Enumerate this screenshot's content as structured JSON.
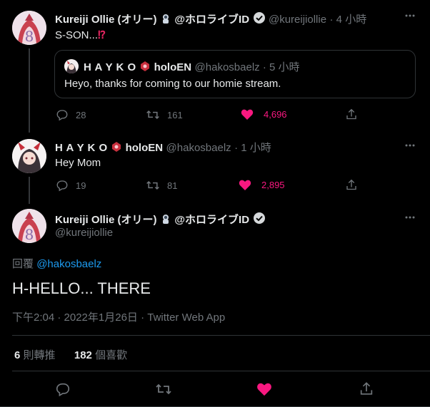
{
  "tweet1": {
    "name": "Kureiji Ollie (オリー)",
    "name_suffix": "@ホロライブID",
    "handle": "@kureijiollie",
    "time": "· 4 小時",
    "text": "S-SON...",
    "emoji": "⁉",
    "quote": {
      "name": "H A Y K O",
      "name_suffix": "holoEN",
      "handle": "@hakosbaelz · 5 小時",
      "text": "Heyo, thanks for coming to our homie stream."
    },
    "replies": "28",
    "retweets": "161",
    "likes": "4,696"
  },
  "tweet2": {
    "name": "H A Y K O",
    "name_suffix": "holoEN",
    "handle": "@hakosbaelz",
    "time": "· 1 小時",
    "text": "Hey Mom",
    "replies": "19",
    "retweets": "81",
    "likes": "2,895"
  },
  "main_tweet": {
    "name": "Kureiji Ollie (オリー)",
    "name_suffix": "@ホロライブID",
    "handle": "@kureijiollie",
    "reply_prefix": "回覆",
    "reply_to": "@hakosbaelz",
    "text": "H-HELLO... THERE",
    "timestamp": "下午2:04 · 2022年1月26日 · Twitter Web App",
    "retweet_count": "6",
    "retweet_label": "則轉推",
    "like_count": "182",
    "like_label": "個喜歡"
  },
  "colors": {
    "like": "#f91880",
    "link": "#1d9bf0",
    "muted": "#71767b"
  }
}
